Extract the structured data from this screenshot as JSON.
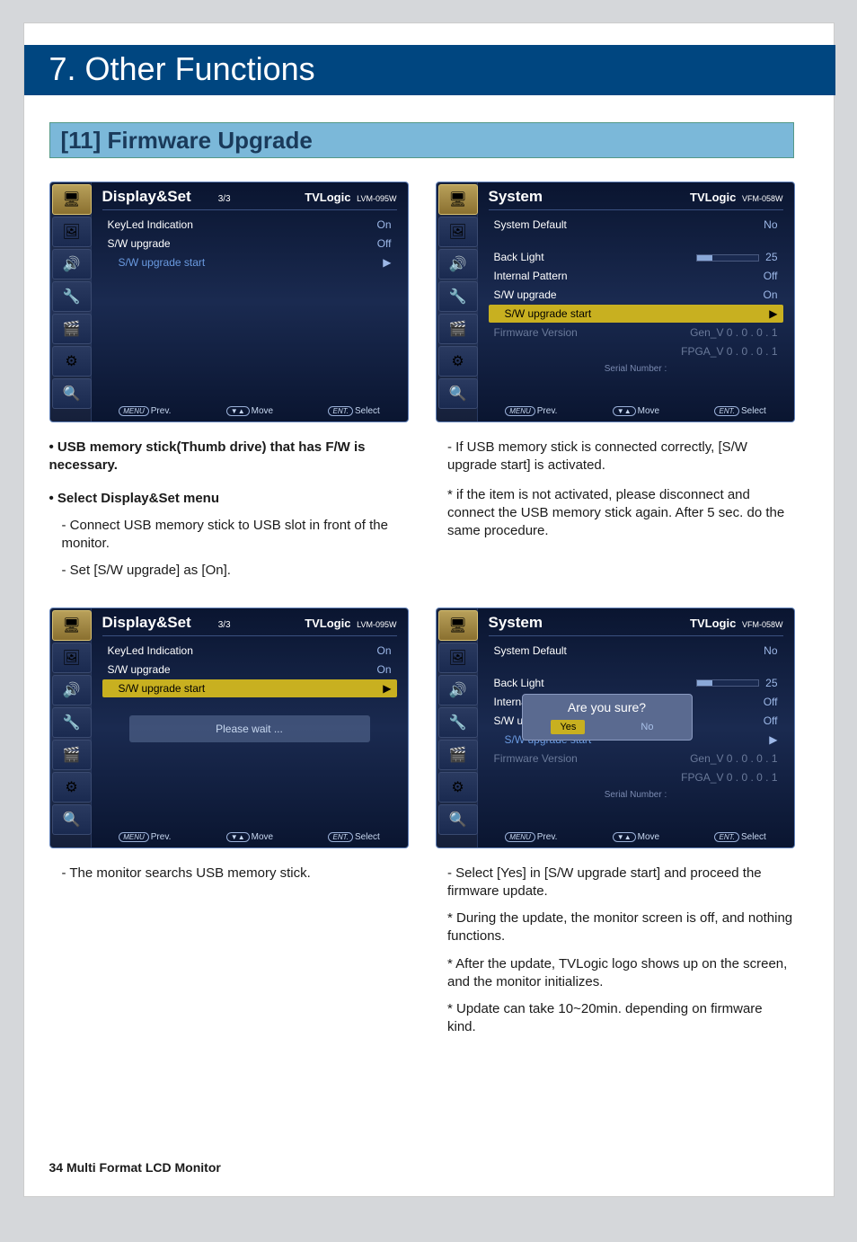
{
  "header": "7. Other Functions",
  "subheader": "[11] Firmware Upgrade",
  "footer": "34 Multi Format LCD Monitor",
  "osd_nav": {
    "menu": "MENU",
    "prev": "Prev.",
    "updn": "▼▲",
    "move": "Move",
    "ent": "ENT.",
    "select": "Select"
  },
  "osdA": {
    "title": "Display&Set",
    "page": "3/3",
    "brand": "TVLogic",
    "model": "LVM-095W",
    "items": [
      {
        "label": "KeyLed Indication",
        "value": "On",
        "sub": false
      },
      {
        "label": "S/W upgrade",
        "value": "Off",
        "sub": false
      },
      {
        "label": "S/W upgrade start",
        "value": "▶",
        "sub": true,
        "hl": false
      }
    ]
  },
  "osdB": {
    "title": "System",
    "brand": "TVLogic",
    "model": "VFM-058W",
    "items": [
      {
        "label": "System Default",
        "value": "No"
      },
      {
        "label": "",
        "value": ""
      },
      {
        "label": "Back Light",
        "value": "25",
        "bar": true
      },
      {
        "label": "Internal Pattern",
        "value": "Off"
      },
      {
        "label": "S/W upgrade",
        "value": "On"
      },
      {
        "label": "S/W upgrade start",
        "value": "▶",
        "sub": true,
        "hl": true
      },
      {
        "label": "Firmware Version",
        "value": "Gen_V 0 . 0 . 0 . 1",
        "dim": true
      },
      {
        "label": "",
        "value": "FPGA_V 0 . 0 . 0 . 1",
        "dim": true
      }
    ],
    "serial": "Serial Number :"
  },
  "osdC": {
    "title": "Display&Set",
    "page": "3/3",
    "brand": "TVLogic",
    "model": "LVM-095W",
    "items": [
      {
        "label": "KeyLed Indication",
        "value": "On"
      },
      {
        "label": "S/W upgrade",
        "value": "On"
      },
      {
        "label": "S/W upgrade start",
        "value": "▶",
        "sub": true,
        "hl": true
      }
    ],
    "wait": "Please wait ..."
  },
  "osdD": {
    "title": "System",
    "brand": "TVLogic",
    "model": "VFM-058W",
    "items": [
      {
        "label": "System Default",
        "value": "No"
      },
      {
        "label": "",
        "value": ""
      },
      {
        "label": "Back Light",
        "value": "25",
        "bar": true
      },
      {
        "label": "Internal Pattern",
        "value": "Off"
      },
      {
        "label": "S/W upgrade",
        "value": "Off"
      },
      {
        "label": "S/W upgrade start",
        "value": "▶",
        "sub": true
      },
      {
        "label": "Firmware Version",
        "value": "Gen_V 0 . 0 . 0 . 1",
        "dim": true
      },
      {
        "label": "",
        "value": "FPGA_V 0 . 0 . 0 . 1",
        "dim": true
      }
    ],
    "serial": "Serial Number :",
    "dialog": {
      "title": "Are you sure?",
      "yes": "Yes",
      "no": "No"
    }
  },
  "textL1": {
    "b1": "• USB memory stick(Thumb drive) that has F/W is necessary.",
    "b2": "• Select Display&Set menu",
    "p1": "- Connect USB memory stick to USB slot in front of the monitor.",
    "p2": "- Set [S/W upgrade] as [On]."
  },
  "textR1": {
    "p1": "- If USB memory stick is connected correctly, [S/W upgrade start] is activated.",
    "p2": "* if the item is not activated, please disconnect and connect the USB memory stick again. After 5 sec. do the same procedure."
  },
  "textL2": {
    "p1": "- The monitor searchs USB memory stick."
  },
  "textR2": {
    "p1": "- Select [Yes] in [S/W upgrade start] and proceed the firmware update.",
    "p2": "* During the update, the monitor screen is off, and nothing functions.",
    "p3": "* After the update, TVLogic logo shows up on the screen, and the monitor initializes.",
    "p4": "* Update can take 10~20min. depending on firmware kind."
  }
}
